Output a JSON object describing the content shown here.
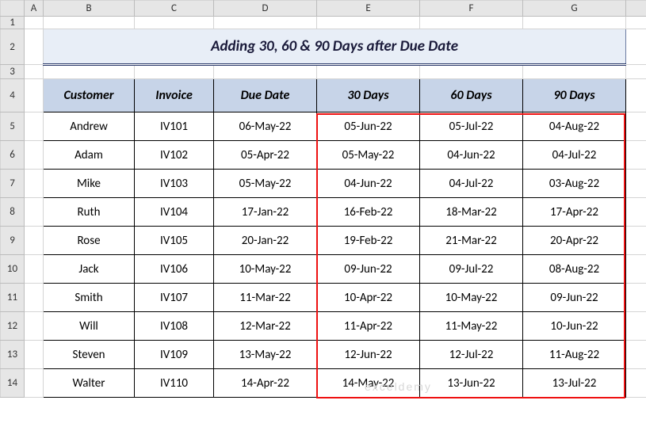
{
  "columns": [
    "A",
    "B",
    "C",
    "D",
    "E",
    "F",
    "G"
  ],
  "row_numbers": [
    1,
    2,
    3,
    4,
    5,
    6,
    7,
    8,
    9,
    10,
    11,
    12,
    13,
    14
  ],
  "title": "Adding 30, 60 & 90 Days after Due Date",
  "headers": {
    "customer": "Customer",
    "invoice": "Invoice",
    "due": "Due Date",
    "d30": "30 Days",
    "d60": "60 Days",
    "d90": "90 Days"
  },
  "rows": [
    {
      "customer": "Andrew",
      "invoice": "IV101",
      "due": "06-May-22",
      "d30": "05-Jun-22",
      "d60": "05-Jul-22",
      "d90": "04-Aug-22"
    },
    {
      "customer": "Adam",
      "invoice": "IV102",
      "due": "05-Apr-22",
      "d30": "05-May-22",
      "d60": "04-Jun-22",
      "d90": "04-Jul-22"
    },
    {
      "customer": "Mike",
      "invoice": "IV103",
      "due": "05-May-22",
      "d30": "04-Jun-22",
      "d60": "04-Jul-22",
      "d90": "03-Aug-22"
    },
    {
      "customer": "Ruth",
      "invoice": "IV104",
      "due": "17-Jan-22",
      "d30": "16-Feb-22",
      "d60": "18-Mar-22",
      "d90": "17-Apr-22"
    },
    {
      "customer": "Rose",
      "invoice": "IV105",
      "due": "20-Jan-22",
      "d30": "19-Feb-22",
      "d60": "21-Mar-22",
      "d90": "20-Apr-22"
    },
    {
      "customer": "Jack",
      "invoice": "IV106",
      "due": "10-May-22",
      "d30": "09-Jun-22",
      "d60": "09-Jul-22",
      "d90": "08-Aug-22"
    },
    {
      "customer": "Smith",
      "invoice": "IV107",
      "due": "11-Mar-22",
      "d30": "10-Apr-22",
      "d60": "10-May-22",
      "d90": "09-Jun-22"
    },
    {
      "customer": "Will",
      "invoice": "IV108",
      "due": "12-Mar-22",
      "d30": "11-Apr-22",
      "d60": "11-May-22",
      "d90": "10-Jun-22"
    },
    {
      "customer": "Steven",
      "invoice": "IV109",
      "due": "13-May-22",
      "d30": "12-Jun-22",
      "d60": "12-Jul-22",
      "d90": "11-Aug-22"
    },
    {
      "customer": "Walter",
      "invoice": "IV110",
      "due": "14-Apr-22",
      "d30": "14-May-22",
      "d60": "13-Jun-22",
      "d90": "13-Jul-22"
    }
  ],
  "watermark": "exceldemy"
}
